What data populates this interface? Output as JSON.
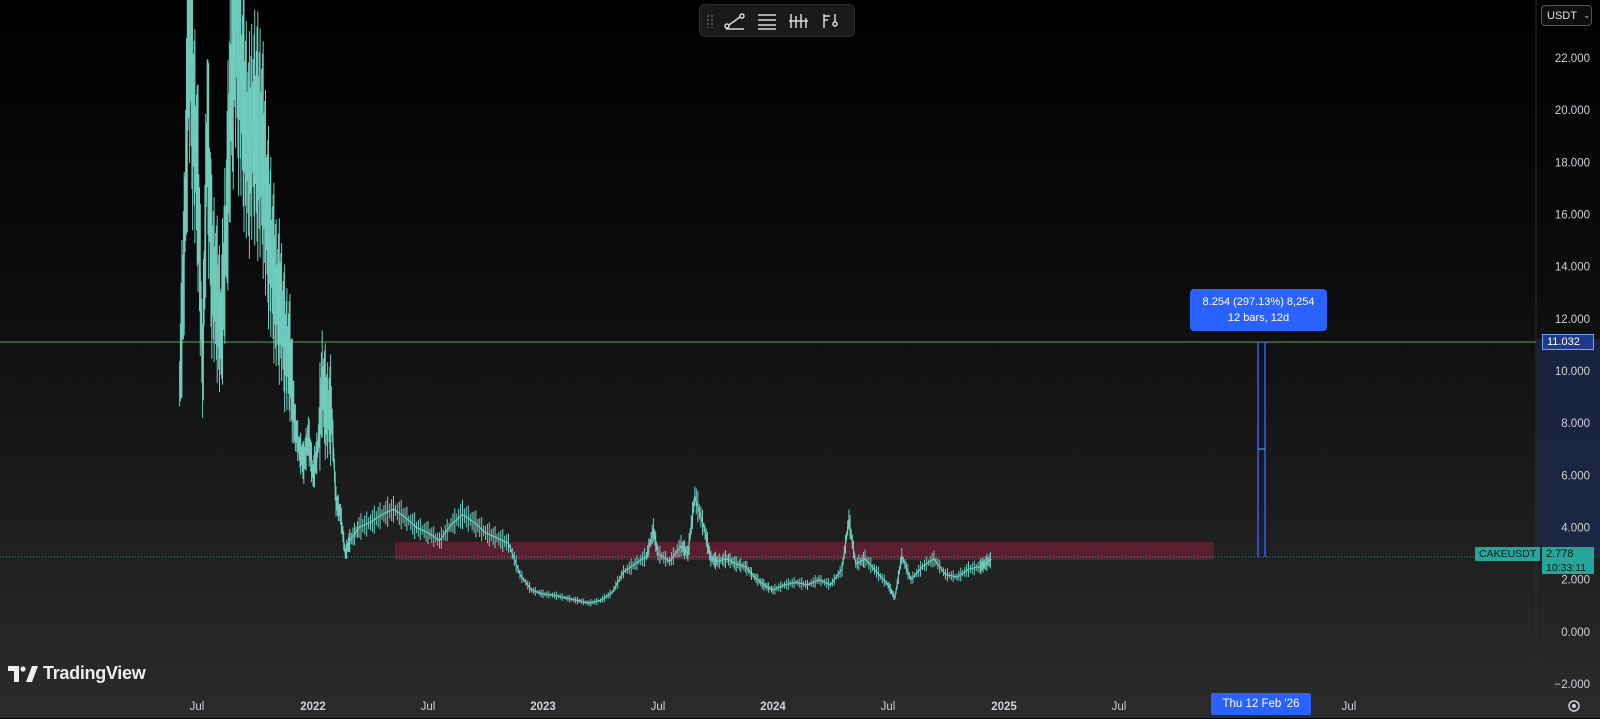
{
  "toolbar": {
    "tools": [
      "trend-line-icon",
      "horizontal-lines-icon",
      "fib-retracement-icon",
      "bar-pattern-icon",
      "long-position-icon"
    ]
  },
  "currency": {
    "label": "USDT"
  },
  "measure": {
    "line1": "8.254 (297.13%) 8,254",
    "line2": "12 bars, 12d"
  },
  "price_tags": {
    "level": "11.032",
    "symbol": "CAKEUSDT",
    "last": "2.778",
    "countdown": "10:33:11"
  },
  "date_tag": "Thu 12 Feb '26",
  "logo": {
    "text": "TradingView"
  },
  "colors": {
    "series": "#70ccbd",
    "level_line": "#4caf50",
    "zone": "#8b1e3f",
    "measure": "#2962ff",
    "last_price": "#26a69a"
  },
  "chart_data": {
    "type": "line",
    "title": "",
    "y_ticks": [
      "22.000",
      "20.000",
      "18.000",
      "16.000",
      "14.000",
      "12.000",
      "10.000",
      "8.000",
      "6.000",
      "4.000",
      "2.000",
      "0.000",
      "−2.000"
    ],
    "x_ticks": [
      "Jul",
      "2022",
      "Jul",
      "2023",
      "Jul",
      "2024",
      "Jul",
      "2025",
      "Jul",
      "Jul"
    ],
    "ylim": [
      -2,
      24
    ],
    "grid": false,
    "horizontal_levels": [
      11.032,
      2.778
    ],
    "zone": {
      "low": 2.5,
      "high": 3.2
    },
    "measure_range": [
      2.778,
      11.032
    ],
    "series": [
      {
        "values": [
          [
            2021.42,
            9.5
          ],
          [
            2021.44,
            14.5
          ],
          [
            2021.46,
            23.5
          ],
          [
            2021.48,
            20.0
          ],
          [
            2021.5,
            17.0
          ],
          [
            2021.52,
            10.0
          ],
          [
            2021.54,
            19.5
          ],
          [
            2021.56,
            14.0
          ],
          [
            2021.58,
            13.0
          ],
          [
            2021.6,
            11.5
          ],
          [
            2021.62,
            15.0
          ],
          [
            2021.64,
            20.0
          ],
          [
            2021.66,
            24.0
          ],
          [
            2021.68,
            22.0
          ],
          [
            2021.7,
            20.0
          ],
          [
            2021.72,
            18.5
          ],
          [
            2021.74,
            19.5
          ],
          [
            2021.76,
            19.0
          ],
          [
            2021.78,
            18.5
          ],
          [
            2021.8,
            16.0
          ],
          [
            2021.82,
            14.5
          ],
          [
            2021.84,
            13.0
          ],
          [
            2021.86,
            12.5
          ],
          [
            2021.88,
            11.0
          ],
          [
            2021.9,
            10.5
          ],
          [
            2021.92,
            8.0
          ],
          [
            2021.94,
            7.0
          ],
          [
            2021.96,
            6.5
          ],
          [
            2021.98,
            7.5
          ],
          [
            2022.0,
            6.0
          ],
          [
            2022.02,
            7.0
          ],
          [
            2022.04,
            9.5
          ],
          [
            2022.06,
            8.5
          ],
          [
            2022.08,
            8.5
          ],
          [
            2022.1,
            5.0
          ],
          [
            2022.12,
            4.5
          ],
          [
            2022.14,
            3.0
          ],
          [
            2022.16,
            3.5
          ],
          [
            2022.2,
            4.0
          ],
          [
            2022.25,
            4.2
          ],
          [
            2022.3,
            4.5
          ],
          [
            2022.35,
            4.7
          ],
          [
            2022.4,
            4.4
          ],
          [
            2022.45,
            4.0
          ],
          [
            2022.5,
            3.8
          ],
          [
            2022.55,
            3.5
          ],
          [
            2022.6,
            4.1
          ],
          [
            2022.65,
            4.5
          ],
          [
            2022.7,
            4.2
          ],
          [
            2022.75,
            3.8
          ],
          [
            2022.8,
            3.6
          ],
          [
            2022.85,
            3.4
          ],
          [
            2022.9,
            2.2
          ],
          [
            2022.95,
            1.6
          ],
          [
            2023.0,
            1.45
          ],
          [
            2023.05,
            1.4
          ],
          [
            2023.1,
            1.3
          ],
          [
            2023.15,
            1.2
          ],
          [
            2023.2,
            1.1
          ],
          [
            2023.25,
            1.2
          ],
          [
            2023.3,
            1.5
          ],
          [
            2023.35,
            2.3
          ],
          [
            2023.4,
            2.6
          ],
          [
            2023.45,
            2.9
          ],
          [
            2023.48,
            3.9
          ],
          [
            2023.5,
            3.0
          ],
          [
            2023.55,
            2.7
          ],
          [
            2023.6,
            3.3
          ],
          [
            2023.63,
            3.0
          ],
          [
            2023.66,
            5.2
          ],
          [
            2023.7,
            4.0
          ],
          [
            2023.73,
            2.8
          ],
          [
            2023.76,
            2.7
          ],
          [
            2023.8,
            2.8
          ],
          [
            2023.84,
            2.6
          ],
          [
            2023.88,
            2.5
          ],
          [
            2023.92,
            2.1
          ],
          [
            2023.96,
            1.8
          ],
          [
            2024.0,
            1.6
          ],
          [
            2024.05,
            1.8
          ],
          [
            2024.1,
            1.9
          ],
          [
            2024.15,
            1.8
          ],
          [
            2024.2,
            2.0
          ],
          [
            2024.25,
            1.8
          ],
          [
            2024.3,
            2.4
          ],
          [
            2024.33,
            4.3
          ],
          [
            2024.36,
            2.6
          ],
          [
            2024.4,
            2.8
          ],
          [
            2024.45,
            2.3
          ],
          [
            2024.5,
            1.8
          ],
          [
            2024.53,
            1.3
          ],
          [
            2024.56,
            2.9
          ],
          [
            2024.6,
            2.0
          ],
          [
            2024.65,
            2.5
          ],
          [
            2024.7,
            2.8
          ],
          [
            2024.75,
            2.2
          ],
          [
            2024.8,
            2.1
          ],
          [
            2024.85,
            2.4
          ],
          [
            2024.9,
            2.5
          ],
          [
            2024.92,
            2.6
          ],
          [
            2024.95,
            2.778
          ]
        ]
      }
    ]
  }
}
